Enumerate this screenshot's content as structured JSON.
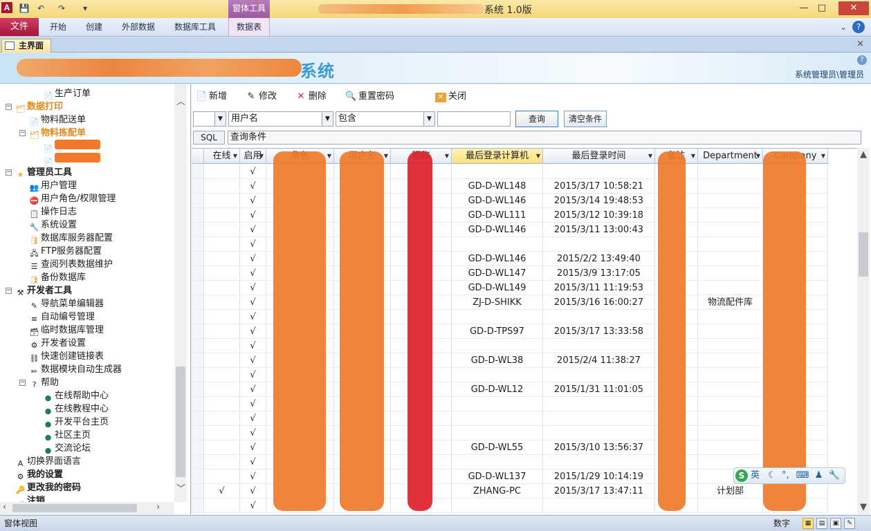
{
  "window": {
    "title": "系统 1.0版",
    "context_tab_group": "窗体工具",
    "minimize": "—",
    "maximize": "□",
    "close": "✕"
  },
  "ribbon": {
    "file": "文件",
    "tabs": [
      "开始",
      "创建",
      "外部数据",
      "数据库工具"
    ],
    "context_tab": "数据表"
  },
  "document_tab": {
    "label": "主界面",
    "close": "×"
  },
  "banner": {
    "system_suffix": "系统",
    "user_info": "系统管理员\\管理员",
    "help": "?"
  },
  "nav": {
    "items": [
      {
        "label": "生产订单",
        "icon": "document-icon",
        "level": 3,
        "style": "normal"
      },
      {
        "label": "数据打印",
        "icon": "folder-icon",
        "level": 1,
        "style": "orange",
        "expander": "−"
      },
      {
        "label": "物料配送单",
        "icon": "document-icon",
        "level": 2,
        "style": "normal"
      },
      {
        "label": "物料拣配单",
        "icon": "folder-icon",
        "level": 2,
        "style": "orange",
        "expander": "−"
      },
      {
        "label": "",
        "icon": "document-icon",
        "level": 3,
        "style": "highlight"
      },
      {
        "label": "",
        "icon": "document-icon",
        "level": 3,
        "style": "highlight"
      },
      {
        "label": "管理员工具",
        "icon": "star-icon",
        "level": 1,
        "style": "bold",
        "expander": "−"
      },
      {
        "label": "用户管理",
        "icon": "users-icon",
        "level": 2,
        "style": "normal"
      },
      {
        "label": "用户角色/权限管理",
        "icon": "no-entry-icon",
        "level": 2,
        "style": "normal"
      },
      {
        "label": "操作日志",
        "icon": "log-icon",
        "level": 2,
        "style": "normal"
      },
      {
        "label": "系统设置",
        "icon": "settings-icon",
        "level": 2,
        "style": "normal"
      },
      {
        "label": "数据库服务器配置",
        "icon": "database-icon",
        "level": 2,
        "style": "normal"
      },
      {
        "label": "FTP服务器配置",
        "icon": "server-icon",
        "level": 2,
        "style": "normal"
      },
      {
        "label": "查阅列表数据维护",
        "icon": "list-icon",
        "level": 2,
        "style": "normal"
      },
      {
        "label": "备份数据库",
        "icon": "database-icon",
        "level": 2,
        "style": "normal"
      },
      {
        "label": "开发者工具",
        "icon": "tools-icon",
        "level": 1,
        "style": "bold",
        "expander": "−"
      },
      {
        "label": "导航菜单编辑器",
        "icon": "edit-icon",
        "level": 2,
        "style": "normal"
      },
      {
        "label": "自动编号管理",
        "icon": "numbering-icon",
        "level": 2,
        "style": "normal"
      },
      {
        "label": "临时数据库管理",
        "icon": "temp-db-icon",
        "level": 2,
        "style": "normal"
      },
      {
        "label": "开发者设置",
        "icon": "dev-settings-icon",
        "level": 2,
        "style": "normal"
      },
      {
        "label": "快速创建链接表",
        "icon": "link-icon",
        "level": 2,
        "style": "normal"
      },
      {
        "label": "数据模块自动生成器",
        "icon": "wand-icon",
        "level": 2,
        "style": "normal"
      },
      {
        "label": "帮助",
        "icon": "help-icon",
        "level": 2,
        "style": "normal",
        "expander": "−"
      },
      {
        "label": "在线帮助中心",
        "icon": "globe-icon",
        "level": 3,
        "style": "normal"
      },
      {
        "label": "在线教程中心",
        "icon": "globe-icon",
        "level": 3,
        "style": "normal"
      },
      {
        "label": "开发平台主页",
        "icon": "globe-icon",
        "level": 3,
        "style": "normal"
      },
      {
        "label": "社区主页",
        "icon": "globe-icon",
        "level": 3,
        "style": "normal"
      },
      {
        "label": "交流论坛",
        "icon": "globe-icon",
        "level": 3,
        "style": "normal"
      },
      {
        "label": "切换界面语言",
        "icon": "language-icon",
        "level": 1,
        "style": "normal"
      },
      {
        "label": "我的设置",
        "icon": "my-settings-icon",
        "level": 1,
        "style": "bold"
      },
      {
        "label": "更改我的密码",
        "icon": "key-icon",
        "level": 1,
        "style": "bold"
      },
      {
        "label": "注销",
        "icon": "logout-icon",
        "level": 1,
        "style": "bold"
      }
    ]
  },
  "toolbar": {
    "new": "新增",
    "edit": "修改",
    "delete": "删除",
    "reset_password": "重置密码",
    "close": "关闭"
  },
  "filter": {
    "logic_value": "",
    "field_value": "用户名",
    "operator_value": "包含",
    "value": "",
    "query": "查询",
    "clear": "清空条件",
    "sql_label": "SQL",
    "sql_condition": "查询条件"
  },
  "grid": {
    "columns": [
      {
        "label": "在线"
      },
      {
        "label": "启用"
      },
      {
        "label": "角色"
      },
      {
        "label": "用户名"
      },
      {
        "label": "昵称"
      },
      {
        "label": "最后登录计算机",
        "selected": true
      },
      {
        "label": "最后登录时间"
      },
      {
        "label": "备注"
      },
      {
        "label": "Department"
      },
      {
        "label": "Company"
      }
    ],
    "rows": [
      {
        "online": "",
        "enabled": "√",
        "computer": "",
        "time": "",
        "dept": ""
      },
      {
        "online": "",
        "enabled": "√",
        "computer": "GD-D-WL148",
        "time": "2015/3/17 10:58:21",
        "dept": ""
      },
      {
        "online": "",
        "enabled": "√",
        "computer": "GD-D-WL146",
        "time": "2015/3/14 19:48:53",
        "dept": ""
      },
      {
        "online": "",
        "enabled": "√",
        "computer": "GD-D-WL111",
        "time": "2015/3/12 10:39:18",
        "dept": ""
      },
      {
        "online": "",
        "enabled": "√",
        "computer": "GD-D-WL146",
        "time": "2015/3/11 13:00:43",
        "dept": ""
      },
      {
        "online": "",
        "enabled": "√",
        "computer": "",
        "time": "",
        "dept": ""
      },
      {
        "online": "",
        "enabled": "√",
        "computer": "GD-D-WL146",
        "time": "2015/2/2 13:49:40",
        "dept": ""
      },
      {
        "online": "",
        "enabled": "√",
        "computer": "GD-D-WL147",
        "time": "2015/3/9 13:17:05",
        "dept": ""
      },
      {
        "online": "",
        "enabled": "√",
        "computer": "GD-D-WL149",
        "time": "2015/3/11 11:19:53",
        "dept": ""
      },
      {
        "online": "",
        "enabled": "√",
        "computer": "ZJ-D-SHIKK",
        "time": "2015/3/16 16:00:27",
        "dept": "物流配件库"
      },
      {
        "online": "",
        "enabled": "√",
        "computer": "",
        "time": "",
        "dept": ""
      },
      {
        "online": "",
        "enabled": "√",
        "computer": "GD-D-TPS97",
        "time": "2015/3/17 13:33:58",
        "dept": ""
      },
      {
        "online": "",
        "enabled": "√",
        "computer": "",
        "time": "",
        "dept": ""
      },
      {
        "online": "",
        "enabled": "√",
        "computer": "GD-D-WL38",
        "time": "2015/2/4 11:38:27",
        "dept": ""
      },
      {
        "online": "",
        "enabled": "√",
        "computer": "",
        "time": "",
        "dept": ""
      },
      {
        "online": "",
        "enabled": "√",
        "computer": "GD-D-WL12",
        "time": "2015/1/31 11:01:05",
        "dept": ""
      },
      {
        "online": "",
        "enabled": "√",
        "computer": "",
        "time": "",
        "dept": ""
      },
      {
        "online": "",
        "enabled": "√",
        "computer": "",
        "time": "",
        "dept": ""
      },
      {
        "online": "",
        "enabled": "√",
        "computer": "",
        "time": "",
        "dept": ""
      },
      {
        "online": "",
        "enabled": "√",
        "computer": "GD-D-WL55",
        "time": "2015/3/10 13:56:37",
        "dept": ""
      },
      {
        "online": "",
        "enabled": "√",
        "computer": "",
        "time": "",
        "dept": ""
      },
      {
        "online": "",
        "enabled": "√",
        "computer": "GD-D-WL137",
        "time": "2015/1/29 10:14:19",
        "dept": ""
      },
      {
        "online": "√",
        "enabled": "√",
        "computer": "ZHANG-PC",
        "time": "2015/3/17 13:47:11",
        "dept": "计划部"
      },
      {
        "online": "",
        "enabled": "√",
        "computer": "",
        "time": "",
        "dept": ""
      }
    ]
  },
  "ime": {
    "logo": "S",
    "mode": "英"
  },
  "status": {
    "left": "窗体视图",
    "numlock": "数字"
  },
  "colors": {
    "accent_file_tab": "#a3163a",
    "context_tab": "#9a5aa0",
    "redaction_orange": "#f07a2a",
    "redaction_red": "#e0202a",
    "selected_header": "#fde27a"
  }
}
